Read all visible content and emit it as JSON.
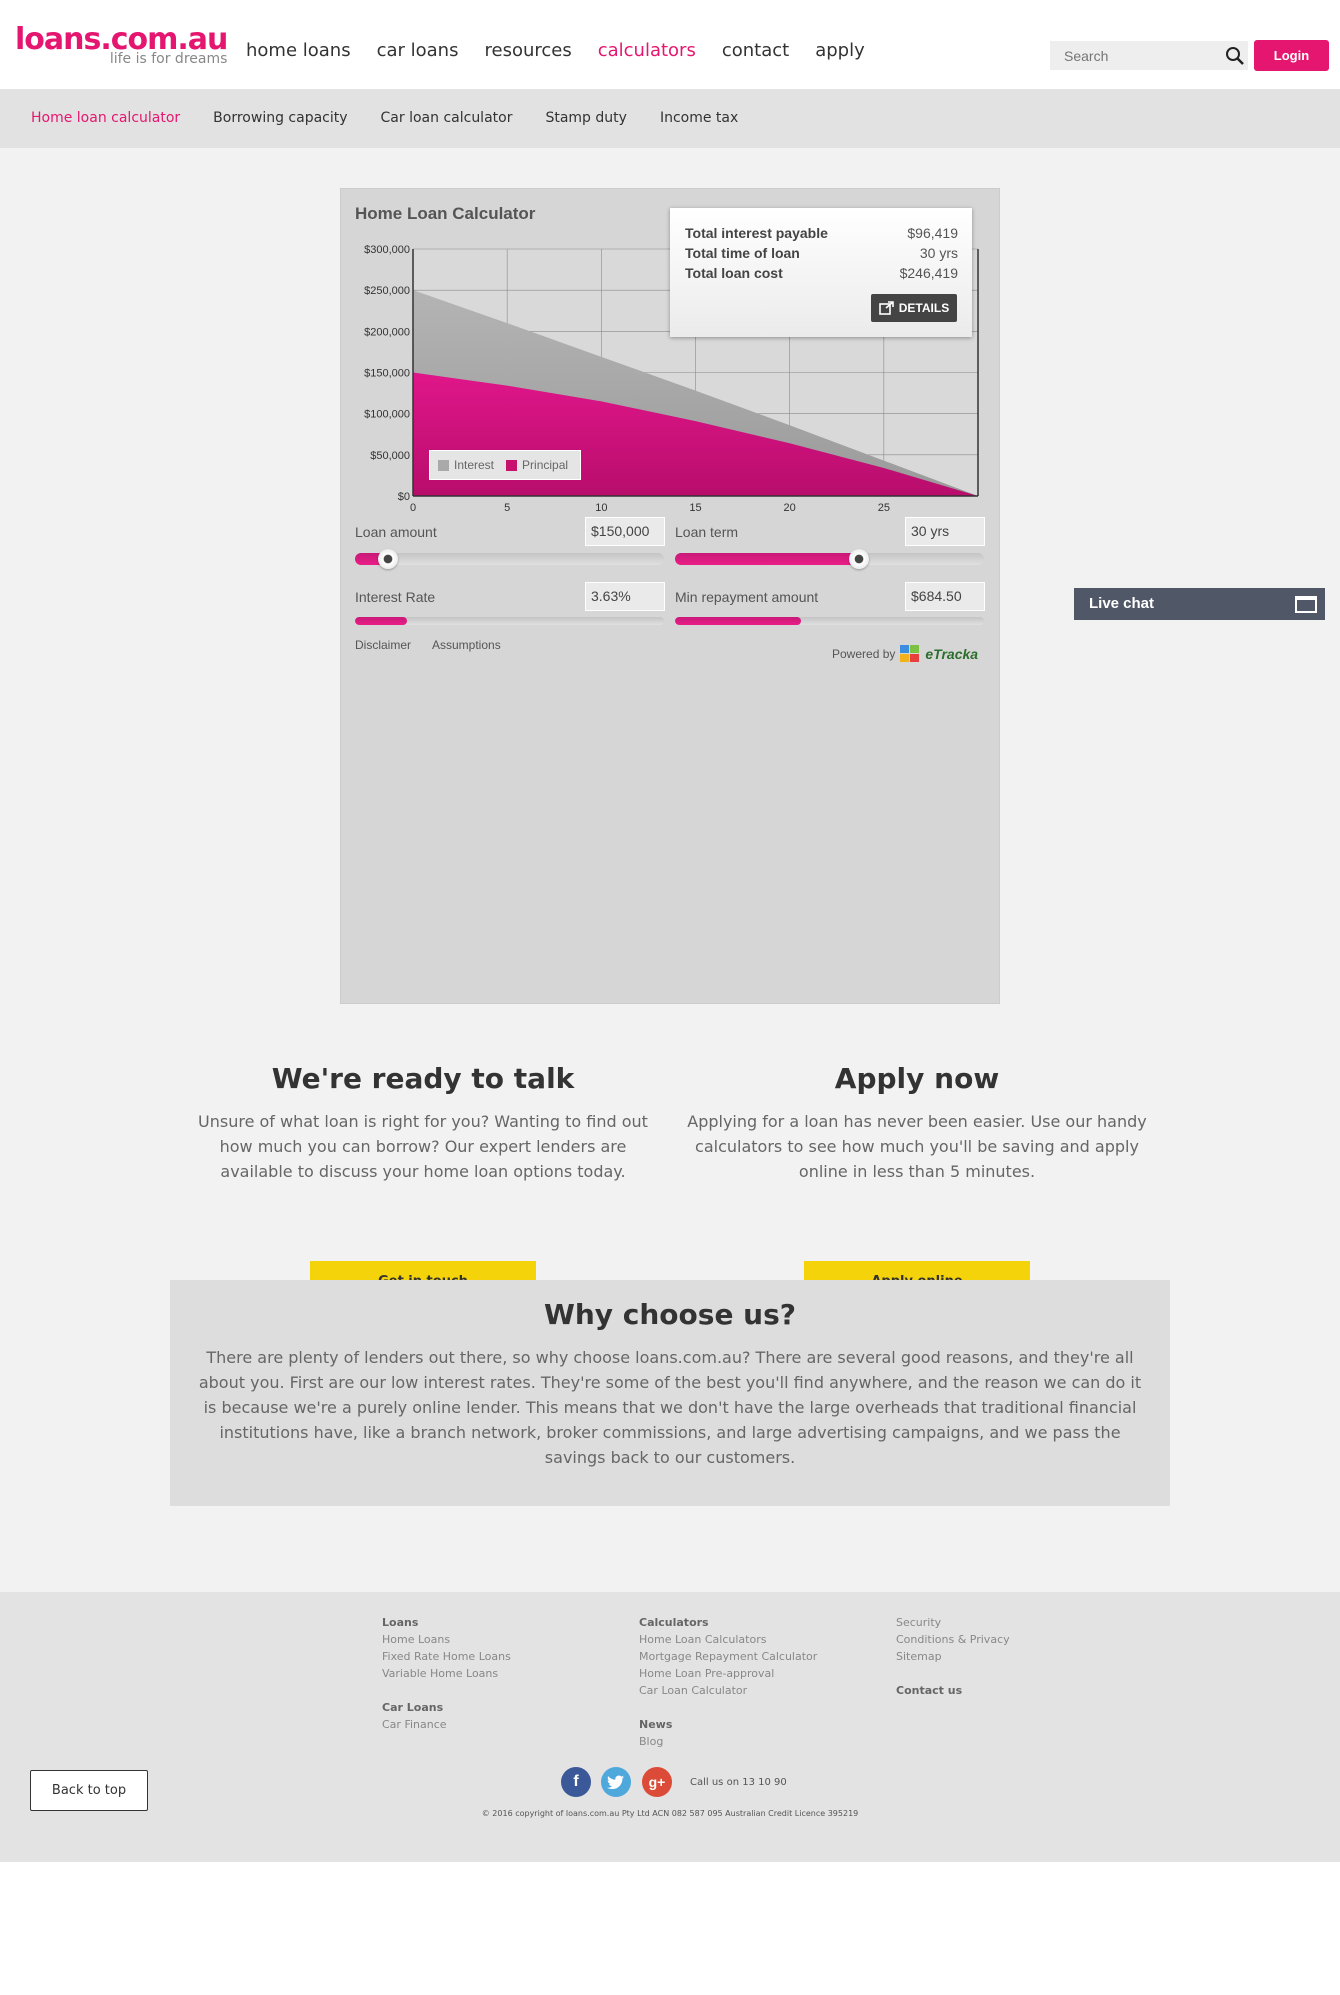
{
  "header": {
    "logo_main": "loans.com.au",
    "logo_tagline": "life is for dreams",
    "nav": [
      "home loans",
      "car loans",
      "resources",
      "calculators",
      "contact",
      "apply"
    ],
    "search_placeholder": "Search",
    "login_label": "Login"
  },
  "subnav": [
    "Home loan calculator",
    "Borrowing capacity",
    "Car loan calculator",
    "Stamp duty",
    "Income tax"
  ],
  "calculator": {
    "title": "Home Loan Calculator",
    "summary": {
      "rows": [
        {
          "label": "Total interest payable",
          "value": "$96,419"
        },
        {
          "label": "Total time of loan",
          "value": "30 yrs"
        },
        {
          "label": "Total loan cost",
          "value": "$246,419"
        }
      ],
      "details_label": "DETAILS"
    },
    "controls": {
      "loan_amount": {
        "label": "Loan amount",
        "value": "$150,000"
      },
      "loan_term": {
        "label": "Loan term",
        "value": "30 yrs"
      },
      "interest_rate": {
        "label": "Interest Rate",
        "value": "3.63%"
      },
      "min_repayment": {
        "label": "Min repayment amount",
        "value": "$684.50"
      }
    },
    "disclaimer": "Disclaimer",
    "assumptions": "Assumptions",
    "powered_by": "Powered by",
    "powered_brand": "eTracka"
  },
  "chart_data": {
    "type": "area",
    "x": [
      0,
      5,
      10,
      15,
      20,
      25,
      30
    ],
    "xticks": [
      "0",
      "5",
      "10",
      "15",
      "20",
      "25"
    ],
    "yticks": [
      "$300,000",
      "$250,000",
      "$200,000",
      "$150,000",
      "$100,000",
      "$50,000",
      "$0"
    ],
    "ylim": [
      0,
      300000
    ],
    "xlim": [
      0,
      30
    ],
    "series": [
      {
        "name": "Interest",
        "color": "#a9a9a9",
        "values": [
          250000,
          210000,
          169000,
          128000,
          86000,
          43000,
          0
        ]
      },
      {
        "name": "Principal",
        "color": "#e01487",
        "values": [
          150000,
          134000,
          115000,
          91000,
          64000,
          34000,
          0
        ]
      }
    ],
    "legend": "bottom-left",
    "grid": true
  },
  "livechat": {
    "label": "Live chat"
  },
  "talk": {
    "title": "We're ready to talk",
    "body": "Unsure of what loan is right for you? Wanting to find out how much you can borrow? Our expert lenders are available to discuss your home loan options today.",
    "button": "Get in touch"
  },
  "apply": {
    "title": "Apply now",
    "body": "Applying for a loan has never been easier. Use our handy calculators to see how much you'll be saving and apply online in less than 5 minutes.",
    "button": "Apply online"
  },
  "why": {
    "title": "Why choose us?",
    "body": "There are plenty of lenders out there, so why choose loans.com.au? There are several good reasons, and they're all about you. First are our low interest rates. They're some of the best you'll find anywhere, and the reason we can do it is because we're a purely online lender. This means that we don't have the large overheads that traditional financial institutions have, like a branch network, broker commissions, and large advertising campaigns, and we pass the savings back to our customers."
  },
  "footer": {
    "col1": {
      "h1": "Loans",
      "items1": [
        "Home Loans",
        "Fixed Rate Home Loans",
        "Variable Home Loans"
      ],
      "h2": "Car Loans",
      "items2": [
        "Car Finance"
      ]
    },
    "col2": {
      "h1": "Calculators",
      "items1": [
        "Home Loan Calculators",
        "Mortgage Repayment Calculator",
        "Home Loan Pre-approval",
        "Car Loan Calculator"
      ],
      "h2": "News",
      "items2": [
        "Blog"
      ]
    },
    "col3": {
      "h1": "Security",
      "items1": [
        "Conditions & Privacy",
        "Sitemap"
      ],
      "h2": "Contact us"
    },
    "back_to_top": "Back to top",
    "call_us": "Call us on 13 10 90",
    "copyright": "© 2016 copyright of loans.com.au Pty Ltd ACN 082 587 095 Australian Credit Licence 395219"
  }
}
